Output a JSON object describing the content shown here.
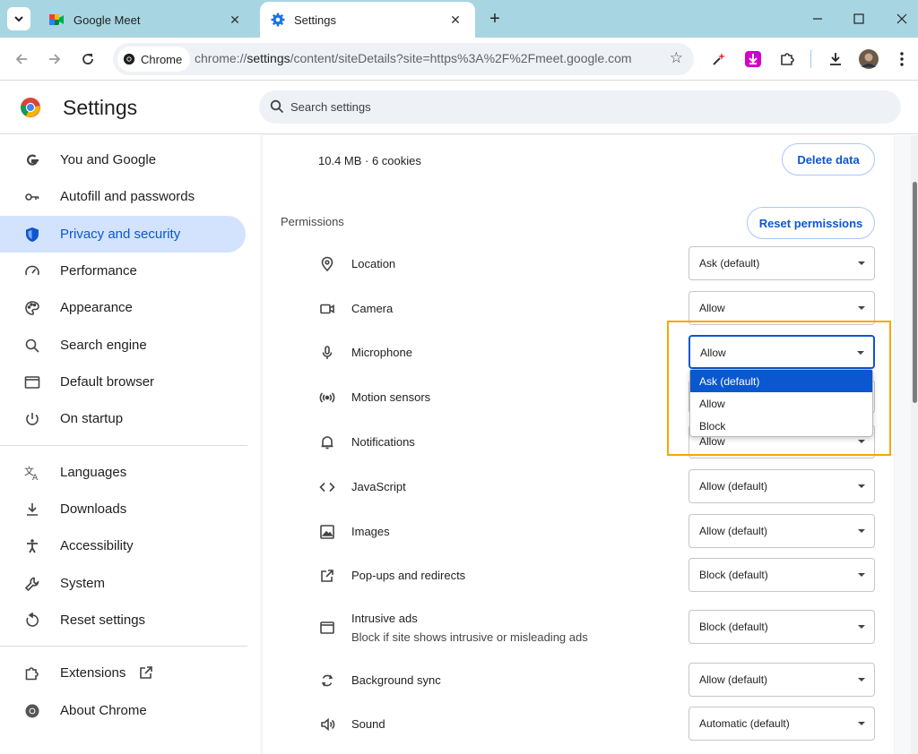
{
  "tabs": [
    {
      "title": "Google Meet"
    },
    {
      "title": "Settings"
    }
  ],
  "toolbar": {
    "chip_label": "Chrome",
    "url_prefix": "chrome://",
    "url_domain": "settings",
    "url_rest": "/content/siteDetails?site=https%3A%2F%2Fmeet.google.com"
  },
  "header": {
    "title": "Settings",
    "search_placeholder": "Search settings"
  },
  "sidebar": {
    "items": [
      {
        "label": "You and Google",
        "icon": "google-g-icon"
      },
      {
        "label": "Autofill and passwords",
        "icon": "key-icon"
      },
      {
        "label": "Privacy and security",
        "icon": "shield-icon",
        "active": true
      },
      {
        "label": "Performance",
        "icon": "speedometer-icon"
      },
      {
        "label": "Appearance",
        "icon": "palette-icon"
      },
      {
        "label": "Search engine",
        "icon": "search-icon"
      },
      {
        "label": "Default browser",
        "icon": "browser-window-icon"
      },
      {
        "label": "On startup",
        "icon": "power-icon"
      },
      {
        "label": "Languages",
        "icon": "translate-icon"
      },
      {
        "label": "Downloads",
        "icon": "download-icon"
      },
      {
        "label": "Accessibility",
        "icon": "accessibility-icon"
      },
      {
        "label": "System",
        "icon": "wrench-icon"
      },
      {
        "label": "Reset settings",
        "icon": "reset-icon"
      },
      {
        "label": "Extensions",
        "icon": "puzzle-icon"
      },
      {
        "label": "About Chrome",
        "icon": "chrome-logo-icon"
      }
    ]
  },
  "site": {
    "usage": "10.4 MB · 6 cookies",
    "delete_label": "Delete data"
  },
  "permissions": {
    "heading": "Permissions",
    "reset_label": "Reset permissions",
    "rows": [
      {
        "label": "Location",
        "value": "Ask (default)",
        "icon": "location-pin-icon"
      },
      {
        "label": "Camera",
        "value": "Allow",
        "icon": "camera-icon"
      },
      {
        "label": "Microphone",
        "value": "Allow",
        "icon": "microphone-icon"
      },
      {
        "label": "Motion sensors",
        "value": "Allow",
        "icon": "motion-sensors-icon"
      },
      {
        "label": "Notifications",
        "value": "Allow",
        "icon": "bell-icon"
      },
      {
        "label": "JavaScript",
        "value": "Allow (default)",
        "icon": "code-icon"
      },
      {
        "label": "Images",
        "value": "Allow (default)",
        "icon": "image-icon"
      },
      {
        "label": "Pop-ups and redirects",
        "value": "Block (default)",
        "icon": "popup-icon"
      },
      {
        "label": "Intrusive ads",
        "sub": "Block if site shows intrusive or misleading ads",
        "value": "Block (default)",
        "icon": "ads-icon"
      },
      {
        "label": "Background sync",
        "value": "Allow (default)",
        "icon": "sync-icon"
      },
      {
        "label": "Sound",
        "value": "Automatic (default)",
        "icon": "speaker-icon"
      }
    ]
  },
  "dropdown": {
    "options": [
      "Ask (default)",
      "Allow",
      "Block"
    ],
    "highlighted": "Ask (default)"
  },
  "colors": {
    "accent": "#0b57d0",
    "active_nav_bg": "#d3e3fd",
    "highlight_border": "#f5a800",
    "tabstrip": "#a8d5e2"
  }
}
